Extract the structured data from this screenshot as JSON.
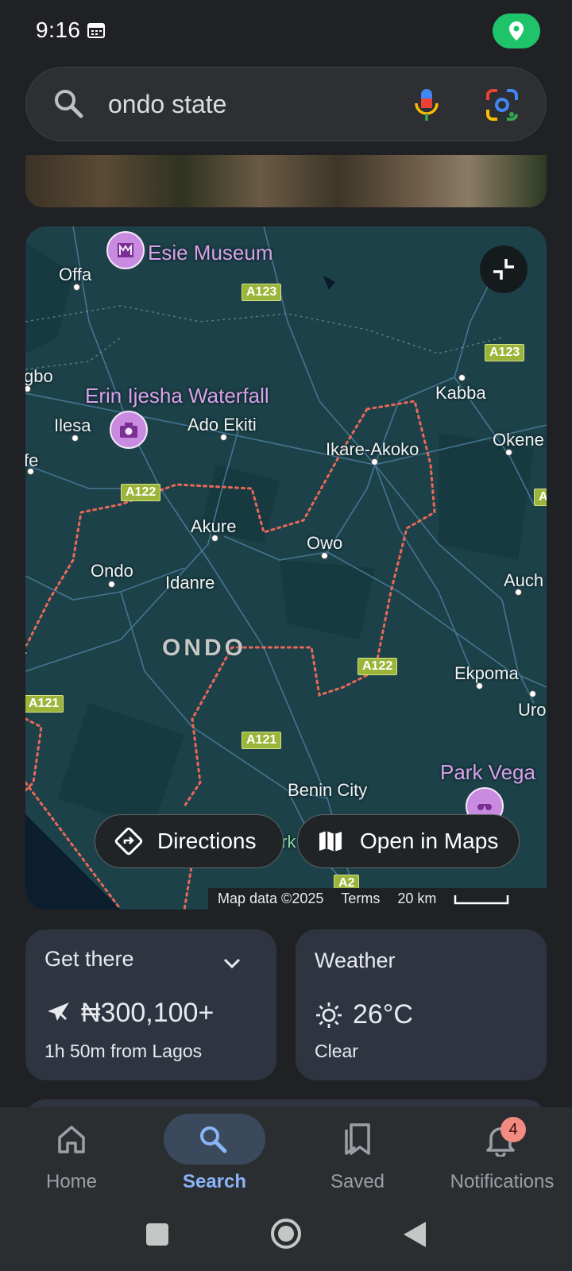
{
  "status_bar": {
    "time": "9:16"
  },
  "search": {
    "query": "ondo state"
  },
  "map": {
    "pois": [
      {
        "label": "Esie Museum",
        "icon": "museum-icon"
      },
      {
        "label": "Erin Ijesha Waterfall",
        "icon": "camera-icon"
      },
      {
        "label": "Park Vega",
        "icon": "park-icon"
      }
    ],
    "places": [
      "Offa",
      "gbo",
      "Ilesa",
      "fe",
      "Ado Ekiti",
      "Kabba",
      "Okene",
      "Ikare-Akoko",
      "Akure",
      "Owo",
      "Ondo",
      "Idanre",
      "Auch",
      "Ekpoma",
      "Uro",
      "Benin City",
      "ark",
      "t"
    ],
    "region": "ONDO",
    "roads": [
      "A123",
      "A123",
      "A",
      "A122",
      "A122",
      "A121",
      "A121",
      "A2"
    ],
    "directions_label": "Directions",
    "open_maps_label": "Open in Maps",
    "attribution": {
      "data": "Map data ©2025",
      "terms": "Terms",
      "scale": "20 km"
    }
  },
  "get_there": {
    "title": "Get there",
    "price": "₦300,100+",
    "duration": "1h 50m from Lagos"
  },
  "weather": {
    "title": "Weather",
    "temp": "26°C",
    "condition": "Clear"
  },
  "nav": {
    "home": "Home",
    "search": "Search",
    "saved": "Saved",
    "notifications": "Notifications",
    "notif_count": "4"
  },
  "colors": {
    "accent": "#8ab4f8",
    "poi": "#c98be0",
    "border": "#e8685a",
    "status_location": "#1fc46a"
  }
}
